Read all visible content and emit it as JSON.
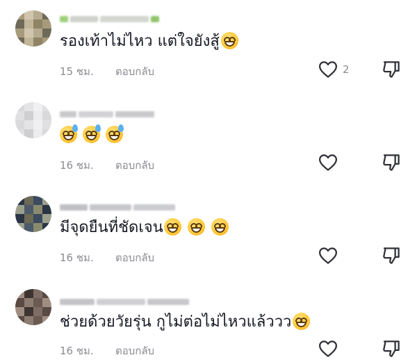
{
  "comments": [
    {
      "text": "รองเท้าไม่ไหว แต่ใจยังสู้",
      "emojis": [
        "grinning"
      ],
      "time": "15 ชม.",
      "reply_label": "ตอบกลับ",
      "like_count": "2",
      "avatar_colors": [
        "#a89b7c",
        "#8f8466",
        "#c2b69a",
        "#6f6a58",
        "#b5ab90",
        "#d0c6ad"
      ]
    },
    {
      "text": "",
      "emojis": [
        "grinning-sweat",
        "grinning-sweat",
        "grinning-sweat"
      ],
      "time": "16 ชม.",
      "reply_label": "ตอบกลับ",
      "like_count": "",
      "avatar_colors": [
        "#e4e4e6",
        "#d9d9dc",
        "#ececee",
        "#cfcfd2",
        "#e0e0e3",
        "#f0f0f2"
      ]
    },
    {
      "text": "มีจุดยืนที่ชัดเจน",
      "emojis": [
        "grinning",
        "grinning",
        "grinning"
      ],
      "time": "16 ชม.",
      "reply_label": "ตอบกลับ",
      "like_count": "",
      "avatar_colors": [
        "#3b4a5e",
        "#6c6a55",
        "#2a3444",
        "#8a8a6e",
        "#4d5a6a",
        "#9aa08c"
      ]
    },
    {
      "text": "ช่วยด้วยวัยรุ่น กูไม่ต่อไม่ไหวแล้ววว",
      "emojis": [
        "grinning"
      ],
      "time": "16 ชม.",
      "reply_label": "ตอบกลับ",
      "like_count": "",
      "avatar_colors": [
        "#5a4a44",
        "#7d6d64",
        "#3e3430",
        "#a08e82",
        "#6a5a52",
        "#8c7c72"
      ]
    }
  ],
  "colors": {
    "text": "#161823",
    "meta": "#8a8b91",
    "icon": "#2f3036"
  },
  "icons": {
    "like": "heart-outline-icon",
    "dislike": "thumbs-down-outline-icon"
  }
}
